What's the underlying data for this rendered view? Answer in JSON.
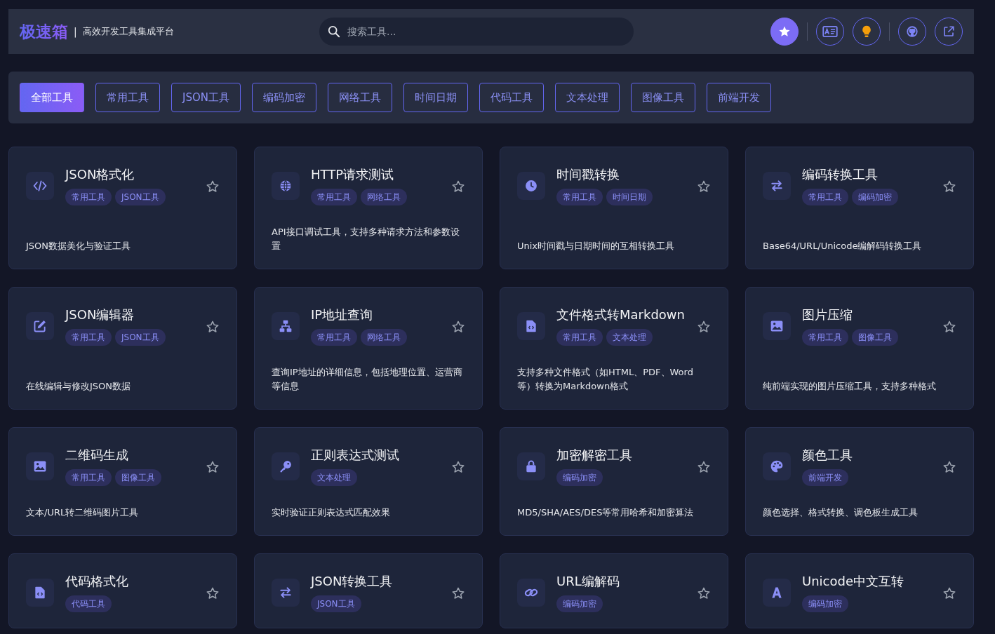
{
  "header": {
    "logo": "极速箱",
    "separator": "|",
    "subtitle": "高效开发工具集成平台",
    "search": {
      "placeholder": "搜索工具..."
    },
    "actions": [
      {
        "kind": "star",
        "primary": true
      },
      {
        "kind": "idcard",
        "primary": false
      },
      {
        "kind": "bulb",
        "primary": false
      },
      {
        "kind": "github",
        "primary": false
      },
      {
        "kind": "external",
        "primary": false
      }
    ]
  },
  "filters": [
    {
      "label": "全部工具",
      "selected": true
    },
    {
      "label": "常用工具",
      "selected": false
    },
    {
      "label": "JSON工具",
      "selected": false
    },
    {
      "label": "编码加密",
      "selected": false
    },
    {
      "label": "网络工具",
      "selected": false
    },
    {
      "label": "时间日期",
      "selected": false
    },
    {
      "label": "代码工具",
      "selected": false
    },
    {
      "label": "文本处理",
      "selected": false
    },
    {
      "label": "图像工具",
      "selected": false
    },
    {
      "label": "前端开发",
      "selected": false
    }
  ],
  "tools": [
    {
      "kind": "code",
      "title": "JSON格式化",
      "tags": [
        "常用工具",
        "JSON工具"
      ],
      "description": "JSON数据美化与验证工具",
      "favorite": false
    },
    {
      "kind": "globe",
      "title": "HTTP请求测试",
      "tags": [
        "常用工具",
        "网络工具"
      ],
      "description": "API接口调试工具，支持多种请求方法和参数设置",
      "favorite": false
    },
    {
      "kind": "clock",
      "title": "时间戳转换",
      "tags": [
        "常用工具",
        "时间日期"
      ],
      "description": "Unix时间戳与日期时间的互相转换工具",
      "favorite": false
    },
    {
      "kind": "swap",
      "title": "编码转换工具",
      "tags": [
        "常用工具",
        "编码加密"
      ],
      "description": "Base64/URL/Unicode编解码转换工具",
      "favorite": false
    },
    {
      "kind": "edit",
      "title": "JSON编辑器",
      "tags": [
        "常用工具",
        "JSON工具"
      ],
      "description": "在线编辑与修改JSON数据",
      "favorite": false
    },
    {
      "kind": "network",
      "title": "IP地址查询",
      "tags": [
        "常用工具",
        "网络工具"
      ],
      "description": "查询IP地址的详细信息，包括地理位置、运营商等信息",
      "favorite": false
    },
    {
      "kind": "filecode",
      "title": "文件格式转Markdown",
      "tags": [
        "常用工具",
        "文本处理"
      ],
      "description": "支持多种文件格式（如HTML、PDF、Word等）转换为Markdown格式",
      "favorite": false
    },
    {
      "kind": "image",
      "title": "图片压缩",
      "tags": [
        "常用工具",
        "图像工具"
      ],
      "description": "纯前端实现的图片压缩工具，支持多种格式",
      "favorite": false
    },
    {
      "kind": "image",
      "title": "二维码生成",
      "tags": [
        "常用工具",
        "图像工具"
      ],
      "description": "文本/URL转二维码图片工具",
      "favorite": false
    },
    {
      "kind": "key",
      "title": "正则表达式测试",
      "tags": [
        "文本处理"
      ],
      "description": "实时验证正则表达式匹配效果",
      "favorite": false
    },
    {
      "kind": "lock",
      "title": "加密解密工具",
      "tags": [
        "编码加密"
      ],
      "description": "MD5/SHA/AES/DES等常用哈希和加密算法",
      "favorite": false
    },
    {
      "kind": "palette",
      "title": "颜色工具",
      "tags": [
        "前端开发"
      ],
      "description": "颜色选择、格式转换、调色板生成工具",
      "favorite": false
    },
    {
      "kind": "filecode",
      "title": "代码格式化",
      "tags": [
        "代码工具"
      ],
      "favorite": false
    },
    {
      "kind": "swap",
      "title": "JSON转换工具",
      "tags": [
        "JSON工具"
      ],
      "favorite": false
    },
    {
      "kind": "link",
      "title": "URL编解码",
      "tags": [
        "编码加密"
      ],
      "favorite": false
    },
    {
      "kind": "font",
      "title": "Unicode中文互转",
      "tags": [
        "编码加密"
      ],
      "favorite": false
    }
  ]
}
